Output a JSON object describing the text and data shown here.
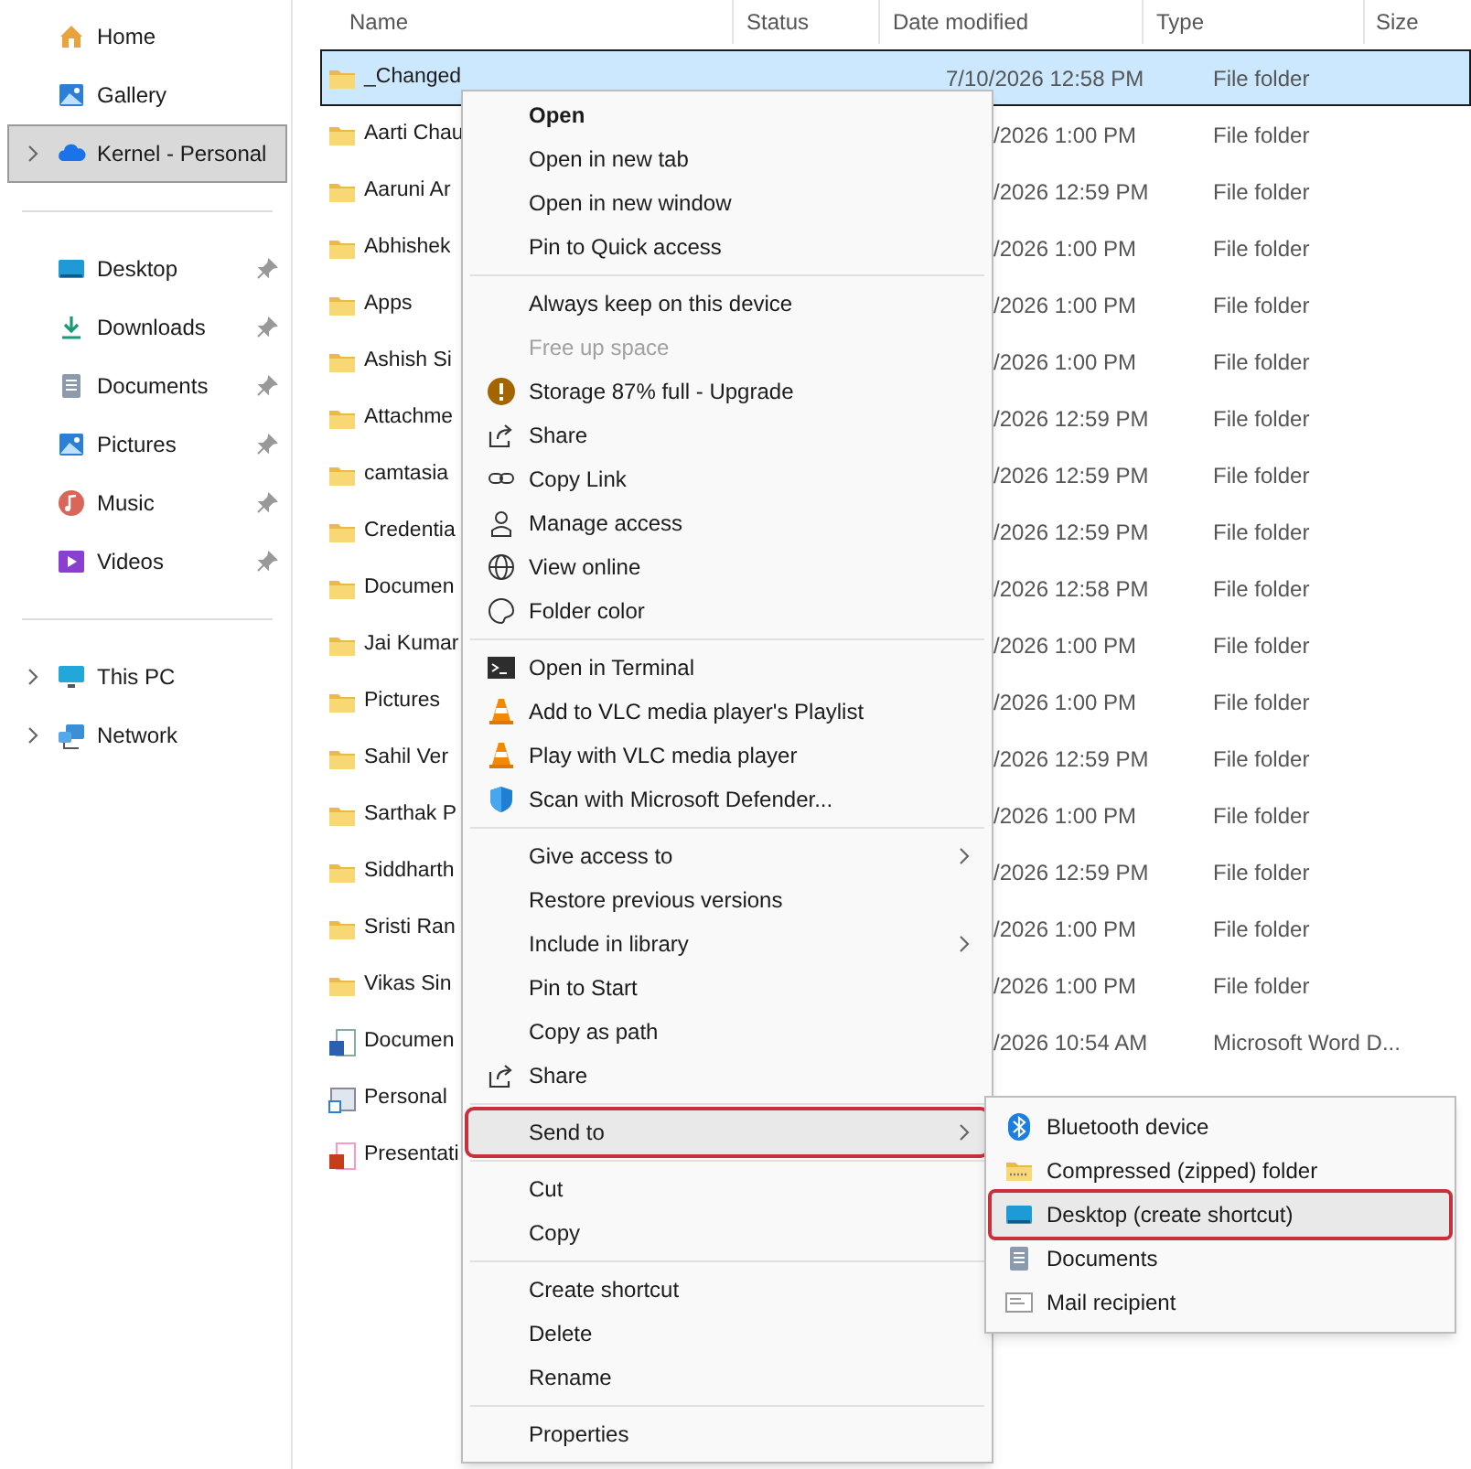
{
  "sidebar": {
    "items": [
      {
        "label": "Home",
        "kind": "home",
        "selected": false,
        "expandable": false,
        "pinned": false
      },
      {
        "label": "Gallery",
        "kind": "gallery",
        "selected": false,
        "expandable": false,
        "pinned": false
      },
      {
        "label": "Kernel - Personal",
        "kind": "cloud",
        "selected": true,
        "expandable": true,
        "pinned": false
      },
      {
        "kind": "divider"
      },
      {
        "label": "Desktop",
        "kind": "desktop",
        "selected": false,
        "expandable": false,
        "pinned": true
      },
      {
        "label": "Downloads",
        "kind": "downloads",
        "selected": false,
        "expandable": false,
        "pinned": true
      },
      {
        "label": "Documents",
        "kind": "documents",
        "selected": false,
        "expandable": false,
        "pinned": true
      },
      {
        "label": "Pictures",
        "kind": "pictures",
        "selected": false,
        "expandable": false,
        "pinned": true
      },
      {
        "label": "Music",
        "kind": "music",
        "selected": false,
        "expandable": false,
        "pinned": true
      },
      {
        "label": "Videos",
        "kind": "videos",
        "selected": false,
        "expandable": false,
        "pinned": true
      },
      {
        "kind": "divider"
      },
      {
        "label": "This PC",
        "kind": "pc",
        "selected": false,
        "expandable": true,
        "pinned": false
      },
      {
        "label": "Network",
        "kind": "network",
        "selected": false,
        "expandable": true,
        "pinned": false
      }
    ]
  },
  "table": {
    "columns": [
      "Name",
      "Status",
      "Date modified",
      "Type",
      "Size"
    ],
    "rows": [
      {
        "kind": "folder",
        "name": "_Changed",
        "date": "7/10/2026 12:58 PM",
        "type": "File folder",
        "selected": true
      },
      {
        "kind": "folder",
        "name": "Aarti Chau",
        "date": "/2026 1:00 PM",
        "type": "File folder",
        "selected": false
      },
      {
        "kind": "folder",
        "name": "Aaruni Ar",
        "date": "/2026 12:59 PM",
        "type": "File folder",
        "selected": false
      },
      {
        "kind": "folder",
        "name": "Abhishek",
        "date": "/2026 1:00 PM",
        "type": "File folder",
        "selected": false
      },
      {
        "kind": "folder",
        "name": "Apps",
        "date": "/2026 1:00 PM",
        "type": "File folder",
        "selected": false
      },
      {
        "kind": "folder",
        "name": "Ashish Si",
        "date": "/2026 1:00 PM",
        "type": "File folder",
        "selected": false
      },
      {
        "kind": "folder",
        "name": "Attachme",
        "date": "/2026 12:59 PM",
        "type": "File folder",
        "selected": false
      },
      {
        "kind": "folder",
        "name": "camtasia",
        "date": "/2026 12:59 PM",
        "type": "File folder",
        "selected": false
      },
      {
        "kind": "folder",
        "name": "Credentia",
        "date": "/2026 12:59 PM",
        "type": "File folder",
        "selected": false
      },
      {
        "kind": "folder",
        "name": "Documen",
        "date": "/2026 12:58 PM",
        "type": "File folder",
        "selected": false
      },
      {
        "kind": "folder",
        "name": "Jai Kumar",
        "date": "/2026 1:00 PM",
        "type": "File folder",
        "selected": false
      },
      {
        "kind": "folder",
        "name": "Pictures",
        "date": "/2026 1:00 PM",
        "type": "File folder",
        "selected": false
      },
      {
        "kind": "folder",
        "name": "Sahil Ver",
        "date": "/2026 12:59 PM",
        "type": "File folder",
        "selected": false
      },
      {
        "kind": "folder",
        "name": "Sarthak P",
        "date": "/2026 1:00 PM",
        "type": "File folder",
        "selected": false
      },
      {
        "kind": "folder",
        "name": "Siddharth",
        "date": "/2026 12:59 PM",
        "type": "File folder",
        "selected": false
      },
      {
        "kind": "folder",
        "name": "Sristi Ran",
        "date": "/2026 1:00 PM",
        "type": "File folder",
        "selected": false
      },
      {
        "kind": "folder",
        "name": "Vikas Sin",
        "date": "/2026 1:00 PM",
        "type": "File folder",
        "selected": false
      },
      {
        "kind": "word",
        "name": "Documen",
        "date": "/2026 10:54 AM",
        "type": "Microsoft Word D...",
        "selected": false
      },
      {
        "kind": "shortcut",
        "name": "Personal",
        "selected": false
      },
      {
        "kind": "powerpoint",
        "name": "Presentati",
        "selected": false
      }
    ]
  },
  "context_menu": {
    "sections": [
      [
        {
          "label": "Open",
          "kind": "none",
          "bold": true
        },
        {
          "label": "Open in new tab",
          "kind": "none"
        },
        {
          "label": "Open in new window",
          "kind": "none"
        },
        {
          "label": "Pin to Quick access",
          "kind": "none"
        }
      ],
      [
        {
          "label": "Always keep on this device",
          "kind": "none"
        },
        {
          "label": "Free up space",
          "kind": "none",
          "disabled": true
        },
        {
          "label": "Storage 87% full - Upgrade",
          "kind": "warning"
        },
        {
          "label": "Share",
          "kind": "share"
        },
        {
          "label": "Copy Link",
          "kind": "link"
        },
        {
          "label": "Manage access",
          "kind": "person"
        },
        {
          "label": "View online",
          "kind": "globe"
        },
        {
          "label": "Folder color",
          "kind": "palette"
        }
      ],
      [
        {
          "label": "Open in Terminal",
          "kind": "terminal"
        },
        {
          "label": "Add to VLC media player's Playlist",
          "kind": "cone"
        },
        {
          "label": "Play with VLC media player",
          "kind": "cone"
        },
        {
          "label": "Scan with Microsoft Defender...",
          "kind": "shield"
        }
      ],
      [
        {
          "label": "Give access to",
          "kind": "none",
          "submenu": true
        },
        {
          "label": "Restore previous versions",
          "kind": "none"
        },
        {
          "label": "Include in library",
          "kind": "none",
          "submenu": true
        },
        {
          "label": "Pin to Start",
          "kind": "none"
        },
        {
          "label": "Copy as path",
          "kind": "none"
        },
        {
          "label": "Share",
          "kind": "share2"
        }
      ],
      [
        {
          "label": "Send to",
          "kind": "none",
          "submenu": true,
          "selected": true
        }
      ],
      [
        {
          "label": "Cut",
          "kind": "none"
        },
        {
          "label": "Copy",
          "kind": "none"
        }
      ],
      [
        {
          "label": "Create shortcut",
          "kind": "none"
        },
        {
          "label": "Delete",
          "kind": "none"
        },
        {
          "label": "Rename",
          "kind": "none"
        }
      ],
      [
        {
          "label": "Properties",
          "kind": "none"
        }
      ]
    ]
  },
  "send_to_menu": {
    "items": [
      {
        "label": "Bluetooth device",
        "kind": "bluetooth",
        "selected": false
      },
      {
        "label": "Compressed (zipped) folder",
        "kind": "zip",
        "selected": false
      },
      {
        "label": "Desktop (create shortcut)",
        "kind": "desktop",
        "selected": true
      },
      {
        "label": "Documents",
        "kind": "documents",
        "selected": false
      },
      {
        "label": "Mail recipient",
        "kind": "mail",
        "selected": false
      }
    ]
  }
}
